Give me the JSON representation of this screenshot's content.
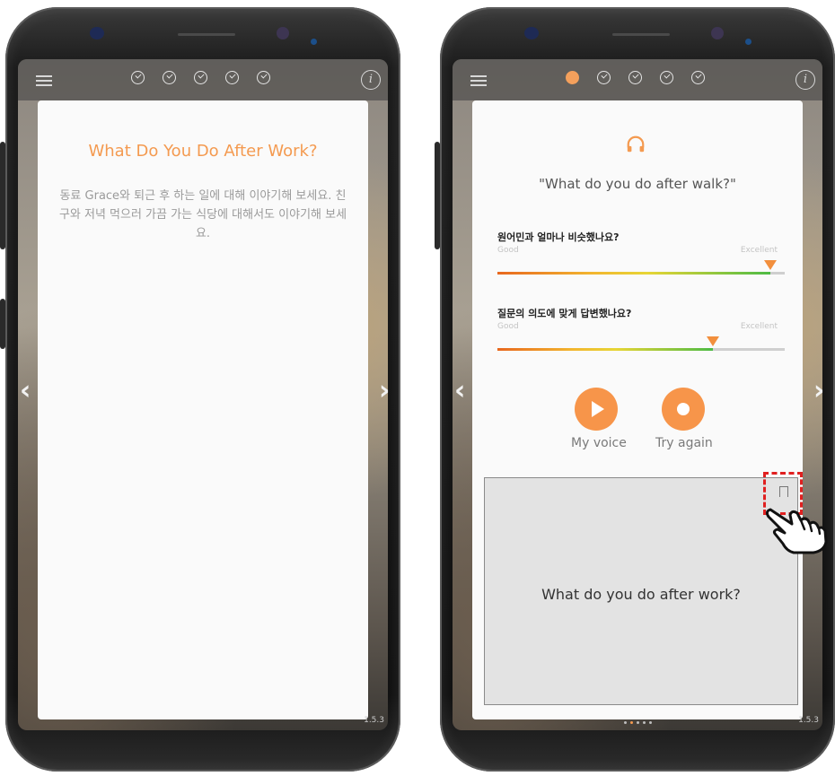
{
  "screen_left": {
    "card": {
      "title": "What Do You Do After Work?",
      "description": "동료 Grace와 퇴근 후 하는 일에 대해 이야기해 보세요. 친구와 저녁 먹으러 가끔 가는 식당에 대해서도 이야기해 보세요."
    },
    "steps": [
      {
        "state": "done",
        "icon": "check-circle-icon"
      },
      {
        "state": "done",
        "icon": "check-circle-icon"
      },
      {
        "state": "done",
        "icon": "check-circle-icon"
      },
      {
        "state": "done",
        "icon": "check-circle-icon"
      },
      {
        "state": "done",
        "icon": "check-circle-icon"
      }
    ],
    "version": "1.5.3"
  },
  "screen_right": {
    "steps": [
      {
        "state": "current"
      },
      {
        "state": "done"
      },
      {
        "state": "done"
      },
      {
        "state": "done"
      },
      {
        "state": "done"
      }
    ],
    "quote": "\"What do you do after walk?\"",
    "ratings": [
      {
        "question": "원어민과 얼마나 비슷했나요?",
        "low": "Good",
        "high": "Excellent",
        "value_fraction": 0.95
      },
      {
        "question": "질문의 의도에 맞게 답변했나요?",
        "low": "Good",
        "high": "Excellent",
        "value_fraction": 0.75
      }
    ],
    "buttons": {
      "my_voice": "My voice",
      "try_again": "Try again"
    },
    "practice_card": {
      "text": "What do you do after work?"
    },
    "page_dots": {
      "count": 5,
      "active_index": 1
    },
    "version": "1.5.3"
  },
  "colors": {
    "accent": "#f49a50",
    "highlight": "#e02020"
  }
}
